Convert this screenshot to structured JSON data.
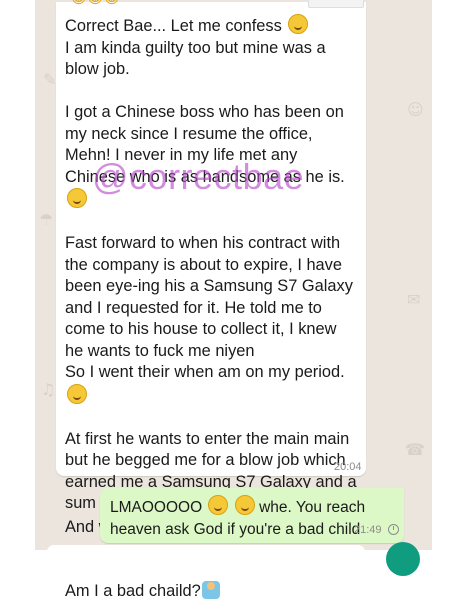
{
  "header_fragment": {
    "emojis": "😂😂😂"
  },
  "incoming_message": {
    "lines": [
      "Correct Bae... Let me confess",
      "I am kinda guilty too but mine was a blow job.",
      "",
      "I got a Chinese boss who has been on my neck since I resume the office, Mehn! I never in my life met any Chinese who is as handsome as he is.",
      "",
      "Fast forward to when his contract with the company is about to expire, I have been eye-ing his a Samsung S7 Galaxy and I requested for it. He told me to come to his house to collect it, I knew  he wants to fuck me niyen",
      "So I went their when am on my period.",
      "",
      "At first he wants to enter the main main but he begged me for a blow job which earned me a Samsung S7 Galaxy and a sum of 70thousand Naira.",
      "And we never met again",
      "",
      "",
      "Am I a bad chaild?"
    ],
    "time": "20:04"
  },
  "watermark": "@correctbae",
  "outgoing_message": {
    "text_before": "LMAOOOOO",
    "text_after": " whe. You reach heaven ask God if you're a bad child",
    "time": "21:49",
    "status_icon": "clock-icon"
  },
  "colors": {
    "chat_background": "#ece5dd",
    "incoming_bubble": "#ffffff",
    "outgoing_bubble": "#dcf8c6",
    "fab": "#0f9c7f",
    "watermark": "#b446c8"
  }
}
